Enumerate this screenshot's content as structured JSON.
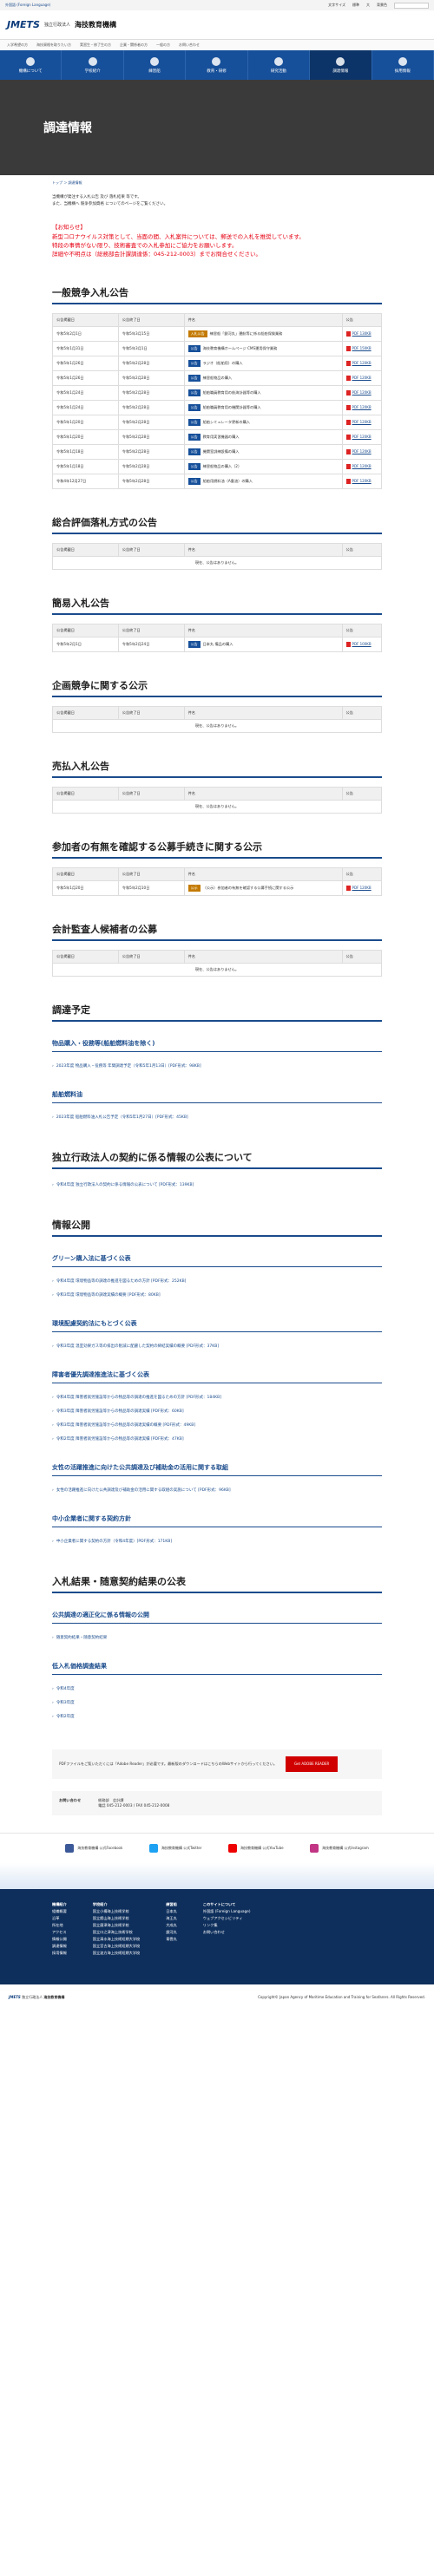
{
  "util": {
    "lang_link": "外国語 (Foreign Language)",
    "text_size_label": "文字サイズ",
    "items": [
      "標準",
      "大"
    ],
    "background_label": "背景色",
    "search_placeholder": "サイト内検索"
  },
  "header": {
    "logo_mark": "JMETS",
    "logo_sub": "独立行政法人",
    "logo_title": "海技教育機構"
  },
  "topnav": [
    "入学希望の方",
    "海技資格を取りたい方",
    "実習生・修了生の方",
    "企業・関係者の方",
    "一般の方",
    "お問い合わせ"
  ],
  "mainnav": [
    "機構について",
    "学校紹介",
    "練習船",
    "教育・研修",
    "研究活動",
    "調達情報",
    "採用情報"
  ],
  "page_title": "調達情報",
  "breadcrumb": "トップ ＞ 調達情報",
  "intro": {
    "line1": "当機構が発注する入札公告 及び 落札結果 等です。",
    "line2": "また、当機構へ 競争参加資格 についてのページをご覧ください。"
  },
  "notice": {
    "l1": "【お知らせ】",
    "l2": "新型コロナウイルス対策として、当面の間、入札案件については、郵送での入札を推奨しています。",
    "l3": "特段の事情がない限り、技術審査での入札参加にご協力をお願いします。",
    "l4": "詳細や不明点は（総務部会計課調達係：045-212-0003）までお問合せください。"
  },
  "headers": {
    "date": "公告掲載日",
    "deadline": "公告終了日",
    "name": "件名",
    "file": "公告"
  },
  "empty_text": "現在、公告はありません。",
  "general": {
    "title": "一般競争入札公告",
    "rows": [
      {
        "date": "令和5年2月1日",
        "deadline": "令和5年3月15日",
        "badge": "入札公告",
        "badge_type": "doc",
        "name": "練習船「銀河丸」運航等に係る船舶保険業務",
        "file": "PDF 130KB"
      },
      {
        "date": "令和5年1月31日",
        "deadline": "令和5年3月1日",
        "badge": "公告",
        "badge_type": "pub",
        "name": "海技教育機構ホームページ CMS運用保守業務",
        "file": "PDF 150KB"
      },
      {
        "date": "令和5年1月26日",
        "deadline": "令和5年2月28日",
        "badge": "公告",
        "badge_type": "pub",
        "name": "ラジオ（船舶用）の購入",
        "file": "PDF 120KB"
      },
      {
        "date": "令和5年1月26日",
        "deadline": "令和5年2月28日",
        "badge": "公告",
        "badge_type": "pub",
        "name": "練習船物品の購入",
        "file": "PDF 120KB"
      },
      {
        "date": "令和5年1月24日",
        "deadline": "令和5年2月28日",
        "badge": "公告",
        "badge_type": "pub",
        "name": "船舶職員教育用の航海計器等の購入",
        "file": "PDF 120KB"
      },
      {
        "date": "令和5年1月24日",
        "deadline": "令和5年2月28日",
        "badge": "公告",
        "badge_type": "pub",
        "name": "船舶職員教育用の機関計器等の購入",
        "file": "PDF 120KB"
      },
      {
        "date": "令和5年1月20日",
        "deadline": "令和5年2月28日",
        "badge": "公告",
        "badge_type": "pub",
        "name": "船舶シミュレータ更新の購入",
        "file": "PDF 120KB"
      },
      {
        "date": "令和5年1月20日",
        "deadline": "令和5年2月28日",
        "badge": "公告",
        "badge_type": "pub",
        "name": "教育用実習機器の購入",
        "file": "PDF 120KB"
      },
      {
        "date": "令和5年1月18日",
        "deadline": "令和5年2月28日",
        "badge": "公告",
        "badge_type": "pub",
        "name": "機関室訓練設備の購入",
        "file": "PDF 120KB"
      },
      {
        "date": "令和5年1月18日",
        "deadline": "令和5年2月28日",
        "badge": "公告",
        "badge_type": "pub",
        "name": "練習船物品の購入（2）",
        "file": "PDF 120KB"
      },
      {
        "date": "令和4年12月27日",
        "deadline": "令和5年2月28日",
        "badge": "公告",
        "badge_type": "pub",
        "name": "船舶用燃料油（A重油）の購入",
        "file": "PDF 120KB"
      }
    ]
  },
  "comprehensive": {
    "title": "総合評価落札方式の公告"
  },
  "simple": {
    "title": "簡易入札公告",
    "rows": [
      {
        "date": "令和5年2月1日",
        "deadline": "令和5年2月24日",
        "badge": "公告",
        "badge_type": "pub",
        "name": "日本丸 備品の購入",
        "file": "PDF 100KB"
      }
    ]
  },
  "planning": {
    "title": "企画競争に関する公示"
  },
  "sales": {
    "title": "売払入札公告"
  },
  "participants": {
    "title": "参加者の有無を確認する公募手続きに関する公示",
    "rows": [
      {
        "date": "令和5年1月20日",
        "deadline": "令和5年2月10日",
        "badge": "公示",
        "badge_type": "doc",
        "name": "（公示）参加者の有無を確認する公募手続に関する公示",
        "file": "PDF 120KB"
      }
    ]
  },
  "auditor": {
    "title": "会計監査人候補者の公募"
  },
  "plan": {
    "title": "調達予定",
    "sub1": "物品購入・役務等(船舶燃料油を除く)",
    "sub1_link": "2023年度 物品購入・役務等 年間調達予定（令和5年1月13日）[PDF形式：98KB]",
    "sub2": "船舶燃料油",
    "sub2_link": "2023年度 船舶燃料油入札公告予定（令和5年1月27日）[PDF形式：45KB]"
  },
  "disclosure": {
    "title": "独立行政法人の契約に係る情報の公表について",
    "link": "令和4年度 独立行政法人の契約に係る情報の公表について [PDF形式：139KB]"
  },
  "info": {
    "title": "情報公開",
    "green_title": "グリーン購入法に基づく公表",
    "green_links": [
      "令和4年度 環境物品等の調達の推進を図るための方針 [PDF形式：252KB]",
      "令和3年度 環境物品等の調達実績の概要 [PDF形式：80KB]"
    ],
    "env_title": "環境配慮契約法にもとづく公表",
    "env_link": "令和3年度 温室効果ガス等の排出の削減に配慮した契約の締結実績の概要 [PDF形式：37KB]",
    "handicap_title": "障害者優先調達推進法に基づく公表",
    "handicap_links": [
      "令和4年度 障害者就労施設等からの物品等の調達の推進を図るための方針 [PDF形式：184KB]",
      "令和3年度 障害者就労施設等からの物品等の調達実績 [PDF形式：60KB]",
      "令和3年度 障害者就労施設等からの物品等の調達実績の概要 [PDF形式：49KB]",
      "令和2年度 障害者就労施設等からの物品等の調達実績 [PDF形式：47KB]"
    ],
    "women_title": "女性の活躍推進に向けた公共調達及び補助金の活用に関する取組",
    "women_link": "女性の活躍推進に向けた公共調達及び補助金の活用に関する取組の実施について [PDF形式：96KB]",
    "small_title": "中小企業者に関する契約方針",
    "small_link": "中小企業者に関する契約の方針（令和4年度）[PDF形式：171KB]"
  },
  "results": {
    "title": "入札結果・随意契約結果の公表",
    "sub1": "公共調達の適正化に係る情報の公開",
    "sub1_link": "随意契約結果・随意契約結果",
    "sub2": "低入札価格調査結果",
    "sub2_links": [
      "令和4年度",
      "令和3年度",
      "令和2年度"
    ]
  },
  "adobe": {
    "text": "PDFファイルをご覧いただくには「Adobe Reader」が必要です。最新版のダウンロードはこちらのWebサイトから行ってください。",
    "button": "Get ADOBE READER"
  },
  "contact": {
    "label": "お問い合わせ",
    "dept": "総務部　会計課",
    "tel": "電話 045-212-0003 / FAX 045-212-0008"
  },
  "sns": [
    "海技教育機構 公式Facebook",
    "海技教育機構 公式Twitter",
    "海技教育機構 公式YouTube",
    "海技教育機構 公式Instagram"
  ],
  "footer": {
    "col1_title": "機構紹介",
    "col1": [
      "組織概要",
      "沿革",
      "所在地",
      "アクセス",
      "情報公開",
      "調達情報",
      "採用情報"
    ],
    "col2_title": "学校紹介",
    "col2": [
      "国立小樽海上技術学校",
      "国立館山海上技術学校",
      "国立唐津海上技術学校",
      "国立口之津海上技術学校",
      "国立清水海上技術短期大学校",
      "国立宮古海上技術短期大学校",
      "国立波方海上技術短期大学校"
    ],
    "col3_title": "練習船",
    "col3": [
      "日本丸",
      "海王丸",
      "大成丸",
      "銀河丸",
      "青雲丸"
    ],
    "col4_title": "このサイトについて",
    "col4": [
      "外国語 (Foreign Language)",
      "ウェブアクセシビリティ",
      "リンク集",
      "お問い合わせ"
    ]
  },
  "copyright": "Copyright© Japan Agency of Maritime Education and Training for Seafarers. All Rights Reserved."
}
